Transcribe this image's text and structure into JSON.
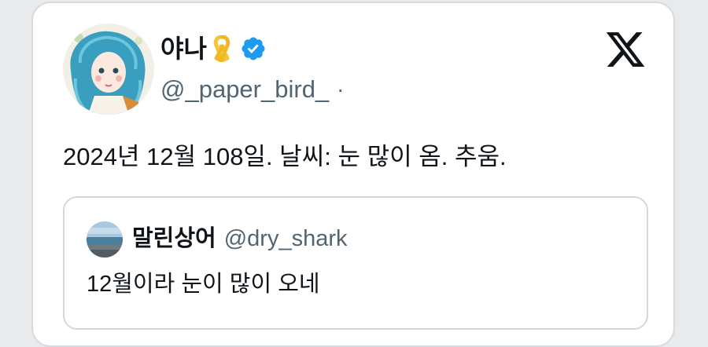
{
  "tweet": {
    "author": {
      "display_name": "야나",
      "handle": "@_paper_bird_",
      "separator": "·",
      "ribbon_icon": "yellow-ribbon-icon",
      "verified_icon": "verified-badge-icon"
    },
    "text": "2024년 12월 108일. 날씨: 눈 많이 옴. 추움.",
    "brand_icon": "x-logo-icon"
  },
  "quote": {
    "display_name": "말린상어",
    "handle": "@dry_shark",
    "text": "12월이라 눈이 많이 오네"
  },
  "colors": {
    "primary_text": "#0f1419",
    "secondary_text": "#536471",
    "verified_blue": "#1d9bf0",
    "ribbon_yellow": "#f5c43c",
    "border": "#cfd9de"
  }
}
